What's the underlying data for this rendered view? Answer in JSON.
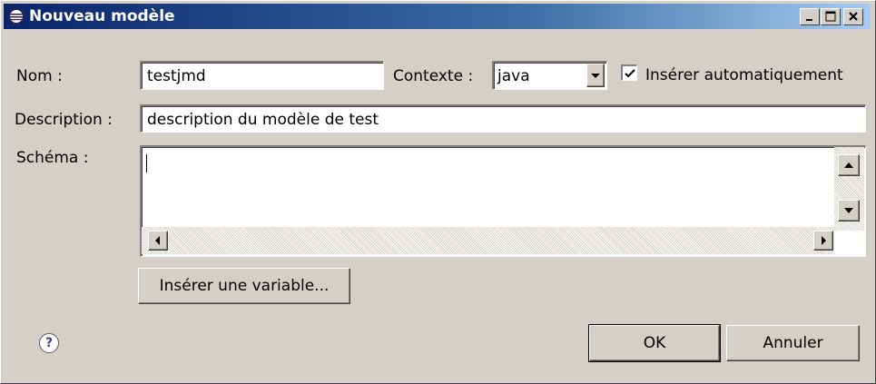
{
  "window": {
    "title": "Nouveau modèle"
  },
  "form": {
    "name_label": "Nom :",
    "name_value": "testjmd",
    "context_label": "Contexte :",
    "context_value": "java",
    "auto_insert_label": "Insérer automatiquement",
    "auto_insert_checked": true,
    "description_label": "Description :",
    "description_value": "description du modèle de test",
    "pattern_label": "Schéma :",
    "pattern_value": "",
    "insert_variable_label": "Insérer une variable..."
  },
  "footer": {
    "ok_label": "OK",
    "cancel_label": "Annuler"
  },
  "icons": {
    "app": "eclipse-icon",
    "help": "help-icon",
    "minimize": "minimize-icon",
    "maximize": "maximize-icon",
    "close": "close-icon"
  },
  "colors": {
    "titlebar_start": "#0a246a",
    "titlebar_end": "#a6caf0",
    "dialog_bg": "#d4d0c8"
  }
}
